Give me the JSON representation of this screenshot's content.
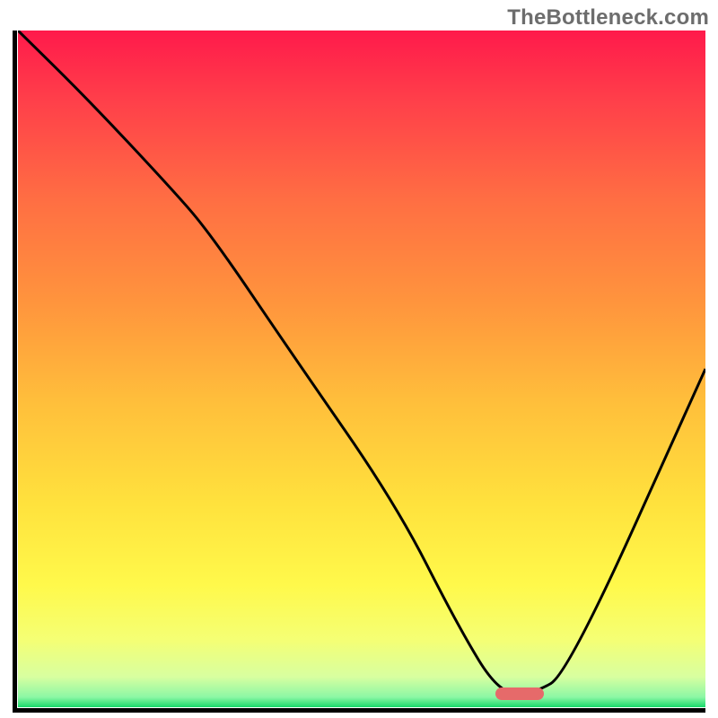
{
  "watermark": "TheBottleneck.com",
  "chart_data": {
    "type": "line",
    "title": "",
    "xlabel": "",
    "ylabel": "",
    "xlim": [
      0,
      100
    ],
    "ylim": [
      0,
      100
    ],
    "grid": false,
    "legend": false,
    "gradient_stops": [
      {
        "pos": 0.0,
        "color": "#ff1a4b"
      },
      {
        "pos": 0.1,
        "color": "#ff3e4a"
      },
      {
        "pos": 0.25,
        "color": "#ff6e43"
      },
      {
        "pos": 0.4,
        "color": "#ff943d"
      },
      {
        "pos": 0.55,
        "color": "#ffbf3b"
      },
      {
        "pos": 0.7,
        "color": "#ffe23d"
      },
      {
        "pos": 0.82,
        "color": "#fff94b"
      },
      {
        "pos": 0.9,
        "color": "#f5ff74"
      },
      {
        "pos": 0.955,
        "color": "#d8ffa0"
      },
      {
        "pos": 0.985,
        "color": "#8cf7a5"
      },
      {
        "pos": 1.0,
        "color": "#18d96b"
      }
    ],
    "series": [
      {
        "name": "bottleneck-curve",
        "x": [
          0,
          10,
          22,
          28,
          40,
          55,
          64,
          70,
          75,
          80,
          100
        ],
        "y": [
          100,
          90,
          77,
          70,
          52,
          30,
          12,
          2,
          2,
          5,
          50
        ]
      }
    ],
    "marker": {
      "name": "optimal-marker",
      "x_center": 73,
      "y": 2,
      "width_pct": 7,
      "color": "#e66a6a"
    }
  }
}
